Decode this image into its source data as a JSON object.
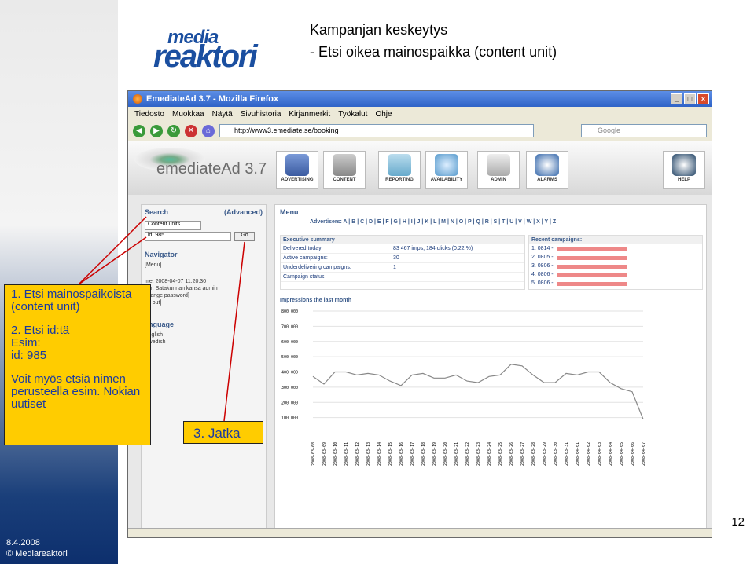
{
  "slide": {
    "title": "Kampanjan keskeytys",
    "subtitle": "- Etsi oikea mainospaikka (content unit)",
    "page_number": "12",
    "footer_date": "8.4.2008",
    "footer_copyright": "© Mediareaktori"
  },
  "logo": {
    "line1": "media",
    "line2": "reaktori"
  },
  "firefox": {
    "title": "EmediateAd 3.7 - Mozilla Firefox",
    "menu": [
      "Tiedosto",
      "Muokkaa",
      "Näytä",
      "Sivuhistoria",
      "Kirjanmerkit",
      "Työkalut",
      "Ohje"
    ],
    "url": "http://www3.emediate.se/booking",
    "search_placeholder": "Google"
  },
  "app": {
    "brand": "emediateAd",
    "version": "3.7",
    "menu": [
      "ADVERTISING",
      "CONTENT",
      "REPORTING",
      "AVAILABILITY",
      "ADMIN",
      "ALARMS",
      "HELP"
    ],
    "search": {
      "heading": "Search",
      "advanced": "(Advanced)",
      "select": "Content units",
      "field": "id: 985",
      "go": "Go"
    },
    "navigator": {
      "heading": "Navigator",
      "item": "[Menu]"
    },
    "session": {
      "time": "me: 2008-04-07 11:20:30",
      "user": "ser: Satakunnan kansa admin",
      "change_pw": "change password]",
      "logout": "og out]"
    },
    "language": {
      "heading": "anguage",
      "english": "English",
      "swedish": "Swedish"
    },
    "main_heading": "Menu",
    "advertisers_label": "Advertisers:",
    "letters": "A | B | C | D | E | F | G | H | I | J | K | L | M | N | O | P | Q | R | S | T | U | V | W | X | Y | Z",
    "executive": {
      "heading": "Executive summary",
      "rows": [
        {
          "k": "Delivered today:",
          "v": "83 467 imps, 184 clicks (0.22 %)"
        },
        {
          "k": "Active campaigns:",
          "v": "30"
        },
        {
          "k": "Underdelivering campaigns:",
          "v": "1"
        },
        {
          "k": "Campaign status",
          "v": ""
        }
      ]
    },
    "recent": {
      "heading": "Recent campaigns:",
      "items": [
        "1. 0814 -",
        "2. 0805 -",
        "3. 0806 -",
        "4. 0806 -",
        "5. 0806 -"
      ]
    },
    "chart_title": "Impressions the last month"
  },
  "chart_data": {
    "type": "line",
    "title": "Impressions the last month",
    "y_ticks": [
      "800 000",
      "700 000",
      "600 000",
      "500 000",
      "400 000",
      "300 000",
      "200 000",
      "100 000"
    ],
    "ylim": [
      0,
      800000
    ],
    "x": [
      "2008-03-08",
      "2008-03-09",
      "2008-03-10",
      "2008-03-11",
      "2008-03-12",
      "2008-03-13",
      "2008-03-14",
      "2008-03-15",
      "2008-03-16",
      "2008-03-17",
      "2008-03-18",
      "2008-03-19",
      "2008-03-20",
      "2008-03-21",
      "2008-03-22",
      "2008-03-23",
      "2008-03-24",
      "2008-03-25",
      "2008-03-26",
      "2008-03-27",
      "2008-03-28",
      "2008-03-29",
      "2008-03-30",
      "2008-03-31",
      "2008-04-01",
      "2008-04-02",
      "2008-04-03",
      "2008-04-04",
      "2008-04-05",
      "2008-04-06",
      "2008-04-07"
    ],
    "values": [
      370000,
      320000,
      400000,
      400000,
      380000,
      390000,
      380000,
      340000,
      310000,
      380000,
      390000,
      360000,
      360000,
      380000,
      340000,
      330000,
      370000,
      380000,
      450000,
      440000,
      380000,
      330000,
      330000,
      390000,
      380000,
      400000,
      400000,
      330000,
      290000,
      270000,
      90000
    ]
  },
  "callouts": {
    "step1": "1. Etsi mainospaikoista (content unit)",
    "step2": "2. Etsi id:tä",
    "step2_ex1": "Esim:",
    "step2_ex2": "id: 985",
    "step2_note": "Voit myös etsiä nimen perusteella esim. Nokian uutiset",
    "step3": "3. Jatka"
  }
}
